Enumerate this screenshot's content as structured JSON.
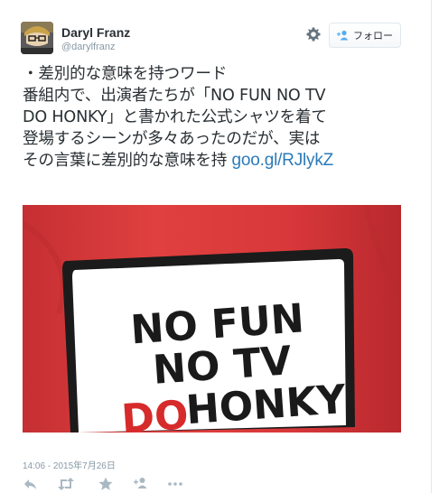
{
  "author": {
    "name": "Daryl Franz",
    "handle": "@darylfranz"
  },
  "follow_button": {
    "label": "フォロー"
  },
  "tweet": {
    "lines": [
      "・差別的な意味を持つワード",
      "番組内で、出演者たちが「NO FUN NO TV",
      "DO HONKY」と書かれた公式シャツを着て",
      "登場するシーンが多々あったのだが、実は",
      "その言葉に差別的な意味を持"
    ],
    "link": "goo.gl/RJlykZ"
  },
  "media": {
    "shirt_text": [
      "NO FUN",
      "NO TV",
      "DO",
      "HONKY"
    ],
    "colors": {
      "shirt": "#d8393b",
      "patch": "#ffffff",
      "text": "#1a1a1a",
      "do_text": "#d72a2a"
    }
  },
  "timestamp": "14:06 - 2015年7月26日",
  "icons": [
    "settings-gear-icon",
    "follow-person-plus-icon",
    "reply-icon",
    "retweet-icon",
    "favorite-star-icon",
    "follow-person-plus-icon",
    "more-dots-icon"
  ],
  "colors": {
    "link": "#2b7bb9",
    "muted": "#8899a6",
    "text": "#292f33"
  }
}
